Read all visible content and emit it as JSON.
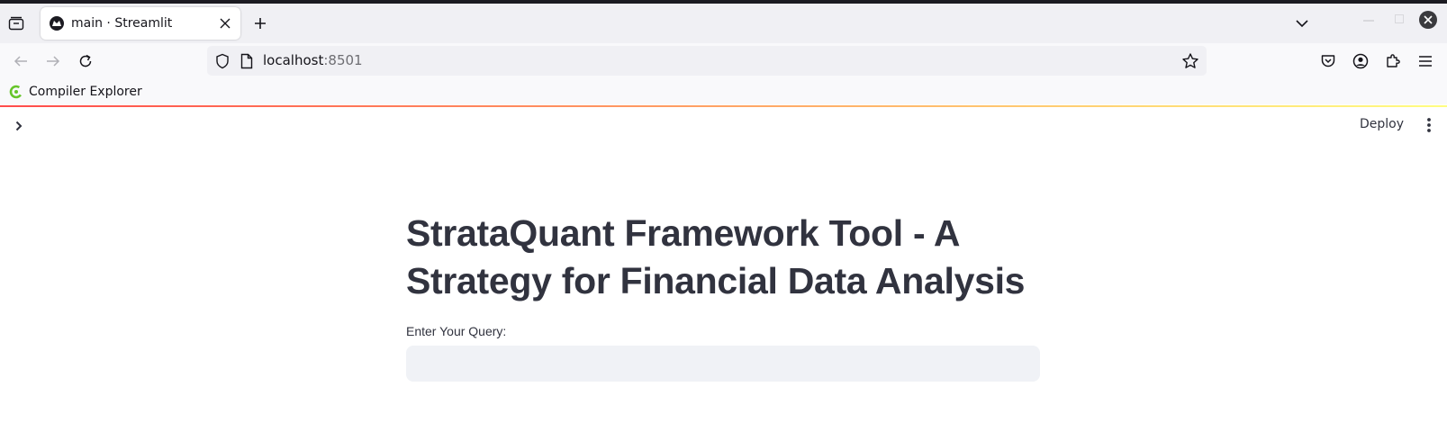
{
  "browser": {
    "tab": {
      "title": "main · Streamlit"
    },
    "url": {
      "host": "localhost",
      "port": ":8501"
    },
    "bookmarks": [
      {
        "label": "Compiler Explorer"
      }
    ]
  },
  "colors": {
    "accent_gradient": [
      "#ff4b4b",
      "#ff9a62",
      "#fffd80"
    ],
    "input_bg": "#f0f2f6",
    "text": "#31333f"
  },
  "app": {
    "toolbar": {
      "deploy_label": "Deploy"
    },
    "title": "StrataQuant Framework Tool - A Strategy for Financial Data Analysis",
    "query": {
      "label": "Enter Your Query:",
      "value": "",
      "placeholder": ""
    }
  }
}
